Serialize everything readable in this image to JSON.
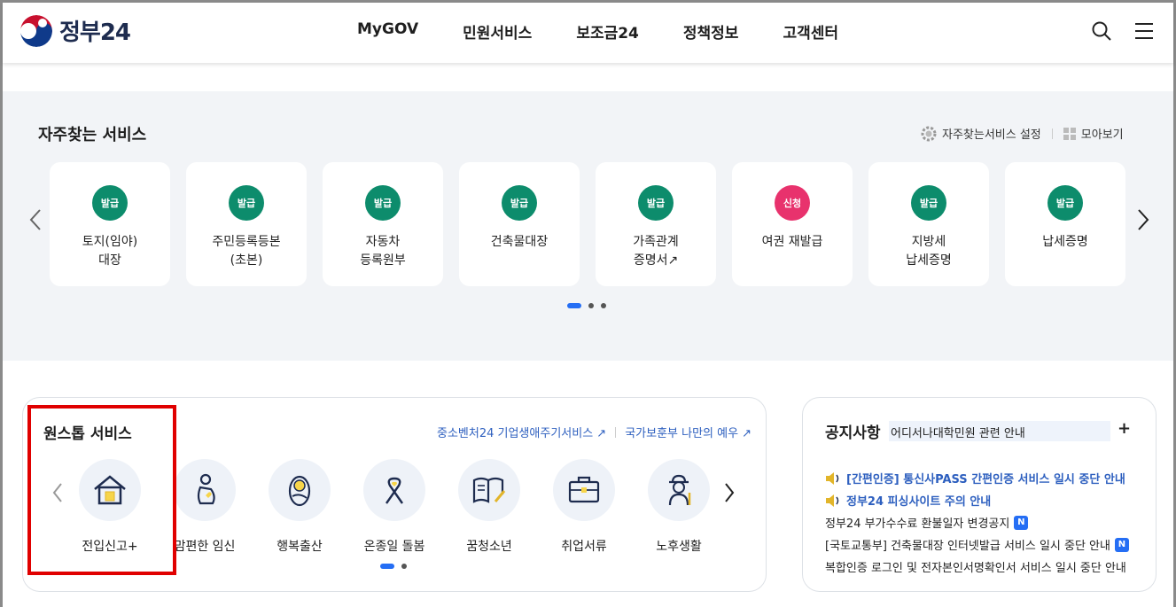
{
  "header": {
    "logo_text": "정부24",
    "nav": [
      "MyGOV",
      "민원서비스",
      "보조금24",
      "정책정보",
      "고객센터"
    ],
    "icons": [
      "search-icon",
      "menu-icon"
    ]
  },
  "frequent": {
    "title": "자주찾는 서비스",
    "settings_label": "자주찾는서비스 설정",
    "collect_label": "모아보기",
    "cards": [
      {
        "badge": "발급",
        "badge_color": "#0d8c6c",
        "label": "토지(임야)\n대장"
      },
      {
        "badge": "발급",
        "badge_color": "#0d8c6c",
        "label": "주민등록등본\n(초본)"
      },
      {
        "badge": "발급",
        "badge_color": "#0d8c6c",
        "label": "자동차\n등록원부"
      },
      {
        "badge": "발급",
        "badge_color": "#0d8c6c",
        "label": "건축물대장"
      },
      {
        "badge": "발급",
        "badge_color": "#0d8c6c",
        "label": "가족관계\n증명서↗"
      },
      {
        "badge": "신청",
        "badge_color": "#e8326d",
        "label": "여권 재발급"
      },
      {
        "badge": "발급",
        "badge_color": "#0d8c6c",
        "label": "지방세\n납세증명"
      },
      {
        "badge": "발급",
        "badge_color": "#0d8c6c",
        "label": "납세증명"
      }
    ]
  },
  "onestop": {
    "title": "원스톱 서비스",
    "link1": "중소벤처24 기업생애주기서비스 ↗",
    "link2": "국가보훈부 나만의 예우 ↗",
    "items": [
      {
        "label": "전입신고+",
        "icon": "house-icon"
      },
      {
        "label": "맘편한 임신",
        "icon": "pregnancy-icon"
      },
      {
        "label": "행복출산",
        "icon": "baby-icon"
      },
      {
        "label": "온종일 돌봄",
        "icon": "ribbon-heart-icon"
      },
      {
        "label": "꿈청소년",
        "icon": "open-book-icon"
      },
      {
        "label": "취업서류",
        "icon": "briefcase-icon"
      },
      {
        "label": "노후생활",
        "icon": "elder-icon"
      }
    ]
  },
  "notice": {
    "title": "공지사항",
    "ticker": "어디서나대학민원 관련 안내",
    "items": [
      {
        "text": "[간편인증] 통신사PASS 간편인증 서비스 일시 중단 안내",
        "highlight": true,
        "new": false
      },
      {
        "text": "정부24 피싱사이트 주의 안내",
        "highlight": true,
        "new": false
      },
      {
        "text": "정부24 부가수수료 환불일자 변경공지",
        "highlight": false,
        "new": true
      },
      {
        "text": "[국토교통부] 건축물대장 인터넷발급 서비스 일시 중단 안내",
        "highlight": false,
        "new": true
      },
      {
        "text": "복합인증 로그인 및 전자본인서명확인서 서비스 일시 중단 안내",
        "highlight": false,
        "new": false
      }
    ],
    "new_badge": "N"
  },
  "colors": {
    "accent": "#256ef4",
    "green": "#0d8c6c",
    "pink": "#e8326d",
    "highlight_box": "#e00000"
  }
}
